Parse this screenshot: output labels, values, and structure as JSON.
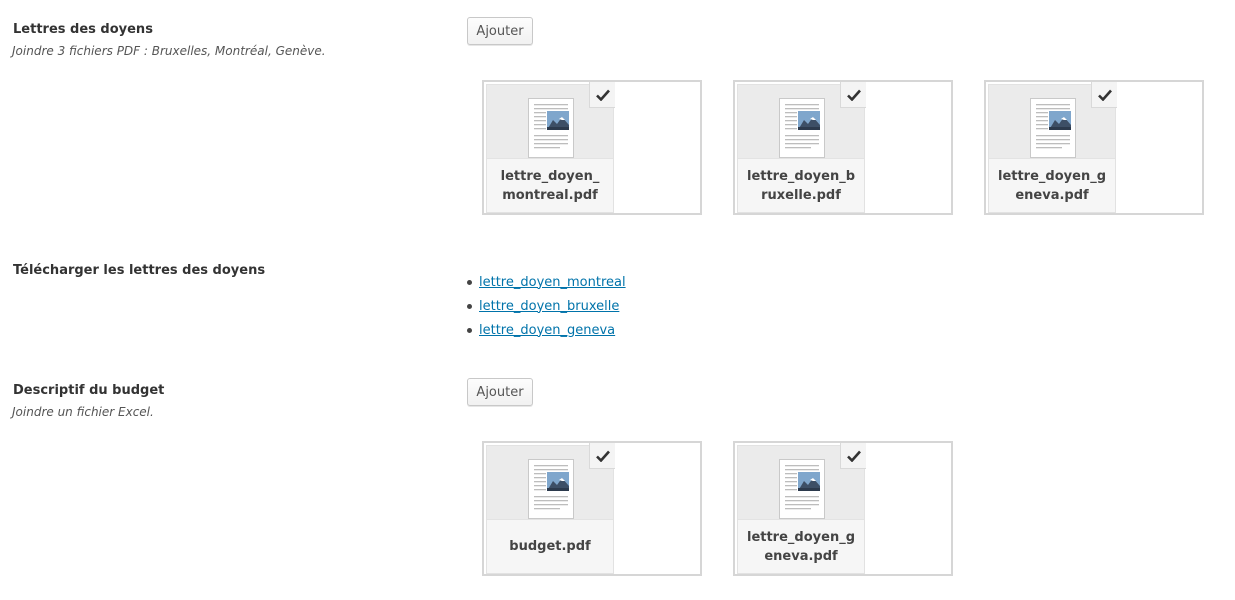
{
  "sections": {
    "letters": {
      "label": "Lettres des doyens",
      "description": "Joindre 3 fichiers PDF : Bruxelles, Montréal, Genève.",
      "add_button": "Ajouter",
      "attachments": [
        {
          "filename": "lettre_doyen_montreal.pdf",
          "checked": true
        },
        {
          "filename": "lettre_doyen_bruxelle.pdf",
          "checked": true
        },
        {
          "filename": "lettre_doyen_geneva.pdf",
          "checked": true
        }
      ]
    },
    "downloads": {
      "label": "Télécharger les lettres des doyens",
      "links": [
        "lettre_doyen_montreal",
        "lettre_doyen_bruxelle",
        "lettre_doyen_geneva"
      ]
    },
    "budget": {
      "label": "Descriptif du budget",
      "description": "Joindre un fichier Excel.",
      "add_button": "Ajouter",
      "attachments": [
        {
          "filename": "budget.pdf",
          "checked": true
        },
        {
          "filename": "lettre_doyen_geneva.pdf",
          "checked": true
        }
      ]
    }
  },
  "icons": {
    "document": "document-thumbnail-icon",
    "check": "checkmark-icon"
  },
  "colors": {
    "link": "#0073aa",
    "tile_bg": "#ebebeb",
    "box_border": "#d6d6d6"
  }
}
